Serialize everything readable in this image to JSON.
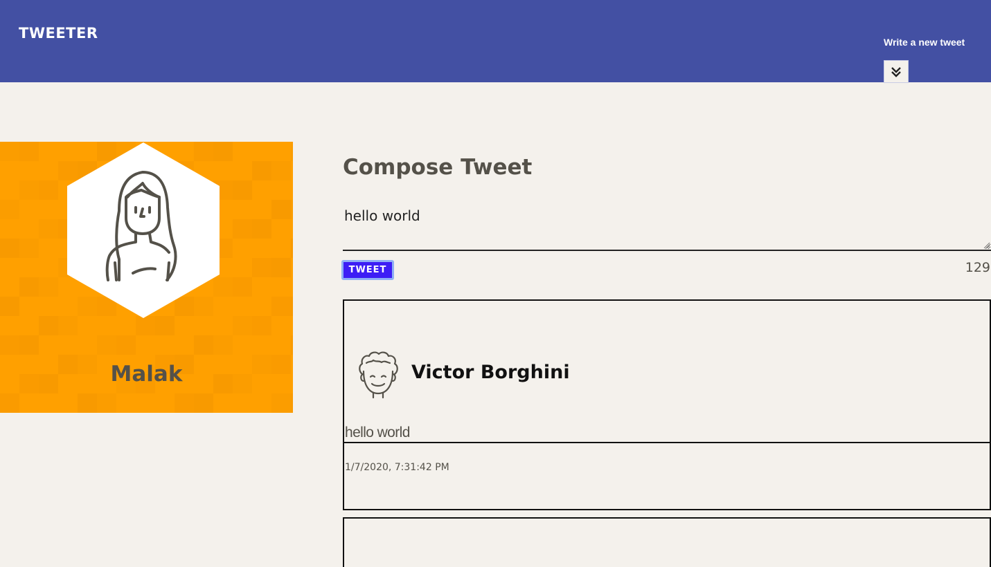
{
  "nav": {
    "brand": "TWEETER",
    "write_link": "Write a new tweet",
    "toggle_icon": "double-chevron-down-icon",
    "background": "#4350a3"
  },
  "profile": {
    "name": "Malak",
    "avatar_icon": "woman-avatar-icon",
    "background": "#ffa000"
  },
  "compose": {
    "title": "Compose Tweet",
    "input_value": "hello world",
    "button_label": "TWEET",
    "char_counter": "129"
  },
  "tweets": [
    {
      "author": "Victor Borghini",
      "avatar_icon": "curly-hair-man-avatar-icon",
      "content": "hello world",
      "timestamp": "1/7/2020, 7:31:42 PM"
    }
  ]
}
